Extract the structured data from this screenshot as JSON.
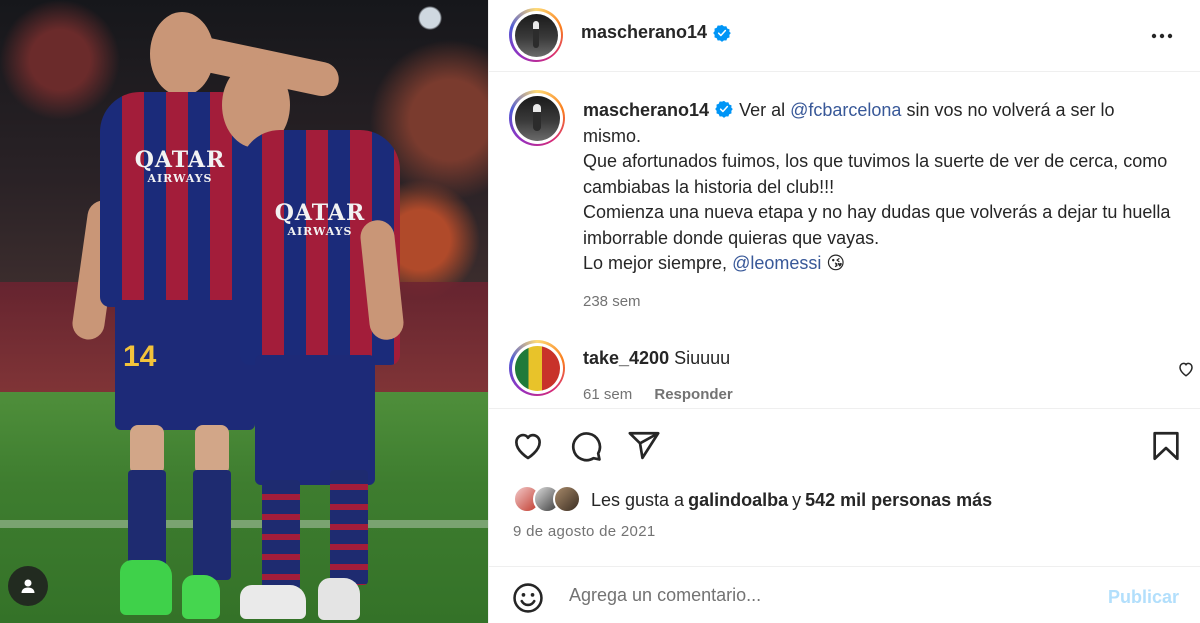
{
  "post": {
    "author": "mascherano14",
    "verified": true
  },
  "caption": {
    "author": "mascherano14",
    "part1": "Ver al ",
    "mention1": "@fcbarcelona",
    "part2": " sin vos no volverá a ser lo mismo.",
    "line2": "Que afortunados fuimos, los que tuvimos la suerte de ver de cerca, como cambiabas la historia del club!!!",
    "line3": "Comienza una nueva etapa y no hay dudas que volverás a dejar tu huella imborrable donde quieras que vayas.",
    "line4_prefix": "Lo mejor siempre, ",
    "mention2": "@leomessi",
    "emoji": "😘",
    "time": "238 sem"
  },
  "comment": {
    "author": "take_4200",
    "text": "Siuuuu",
    "time": "61 sem",
    "reply_label": "Responder"
  },
  "likes": {
    "prefix": "Les gusta a ",
    "liker": "galindoalba",
    "connector": " y ",
    "others": "542 mil personas más"
  },
  "date": "9 de agosto de 2021",
  "comment_box": {
    "placeholder": "Agrega un comentario...",
    "publish_label": "Publicar"
  },
  "photo": {
    "sponsor": "QATAR",
    "sponsor_sub": "AIRWAYS",
    "shirt_number": "14"
  },
  "colors": {
    "mention": "#385898",
    "verified": "#0095f6",
    "publish_disabled": "#b2dffc"
  },
  "icons": [
    "more-options-icon",
    "verified-badge-icon",
    "heart-icon",
    "comment-icon",
    "share-icon",
    "bookmark-icon",
    "emoji-icon",
    "user-avatar-icon"
  ]
}
